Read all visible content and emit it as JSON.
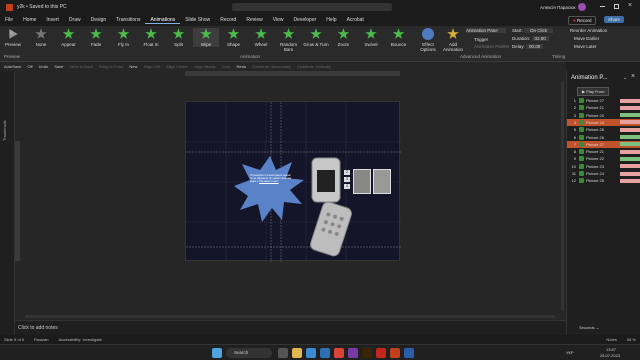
{
  "titlebar": {
    "title": "y2k • Saved to this PC",
    "user": "Алексія Парасюк",
    "record": "Record",
    "share": "Share"
  },
  "menu": [
    "File",
    "Home",
    "Insert",
    "Draw",
    "Design",
    "Transitions",
    "Animations",
    "Slide Show",
    "Record",
    "Review",
    "View",
    "Developer",
    "Help",
    "Acrobat"
  ],
  "ribbon": {
    "preview": "Preview",
    "effects": [
      "None",
      "Appear",
      "Fade",
      "Fly In",
      "Float In",
      "Split",
      "Wipe",
      "Shape",
      "Wheel",
      "Random Bars",
      "Grow & Turn",
      "Zoom",
      "Swivel",
      "Bounce"
    ],
    "effect_options": "Effect Options",
    "add_animation": "Add Animation",
    "animation_pane": "Animation Pane",
    "trigger": "Trigger",
    "animation_painter": "Animation Painter",
    "start_label": "Start:",
    "start_value": "On Click",
    "duration_label": "Duration:",
    "duration_value": "02.00",
    "delay_label": "Delay:",
    "delay_value": "00.00",
    "reorder": "Reorder Animation",
    "move_earlier": "Move Earlier",
    "move_later": "Move Later",
    "group_preview": "Preview",
    "group_animation": "Animation",
    "group_advanced": "Advanced Animation",
    "group_timing": "Timing"
  },
  "qat": [
    {
      "label": "AutoSave",
      "dim": false
    },
    {
      "label": "Off",
      "dim": false
    },
    {
      "label": "Undo",
      "dim": false
    },
    {
      "label": "Save",
      "dim": false
    },
    {
      "label": "Send to Back",
      "dim": true
    },
    {
      "label": "Bring to Front",
      "dim": true
    },
    {
      "label": "New",
      "dim": false
    },
    {
      "label": "Align Left",
      "dim": true
    },
    {
      "label": "Align Center",
      "dim": true
    },
    {
      "label": "Align Middle",
      "dim": true
    },
    {
      "label": "Crop",
      "dim": true
    },
    {
      "label": "Redo",
      "dim": false
    },
    {
      "label": "Distribute Horizontally",
      "dim": true
    },
    {
      "label": "Distribute Vertically",
      "dim": true
    }
  ],
  "thumbnails_label": "Thumbnails",
  "slide": {
    "burst_text": "Отримувати та виконувати надані та за завдання тип даних програм відео з ",
    "burst_link": "Поставити текст"
  },
  "notes_placeholder": "Click to add notes",
  "status": {
    "slide": "Slide 5 of 5",
    "language": "Russian",
    "accessibility": "Accessibility: Investigate",
    "notes": "Notes",
    "zoom": "56 %"
  },
  "pane": {
    "title": "Animation P...",
    "play": "Play From",
    "items": [
      {
        "num": "1",
        "label": "Picture 27",
        "color": "#e8a0a0",
        "sel": false
      },
      {
        "num": "2",
        "label": "Picture 21",
        "color": "#e8a0a0",
        "sel": false
      },
      {
        "num": "3",
        "label": "Picture 20",
        "color": "#7ec07e",
        "sel": false
      },
      {
        "num": "4",
        "label": "Picture 24",
        "color": "#e8a0a0",
        "sel": true
      },
      {
        "num": "5",
        "label": "Picture 25",
        "color": "#e8a0a0",
        "sel": false
      },
      {
        "num": "6",
        "label": "Picture 26",
        "color": "#7ec07e",
        "sel": false
      },
      {
        "num": "7",
        "label": "Picture 27",
        "color": "#7ec07e",
        "sel": true
      },
      {
        "num": "8",
        "label": "Picture 21",
        "color": "#e8a0a0",
        "sel": false
      },
      {
        "num": "9",
        "label": "Picture 22",
        "color": "#7ec07e",
        "sel": false
      },
      {
        "num": "10",
        "label": "Picture 23",
        "color": "#e8a0a0",
        "sel": false
      },
      {
        "num": "11",
        "label": "Picture 24",
        "color": "#e8a0a0",
        "sel": false
      },
      {
        "num": "12",
        "label": "Picture 25",
        "color": "#e8a0a0",
        "sel": false
      }
    ],
    "seconds": "Seconds"
  },
  "taskbar": {
    "search": "Search",
    "lang": "УКР",
    "time": "13:57",
    "date": "28.07.2023"
  }
}
